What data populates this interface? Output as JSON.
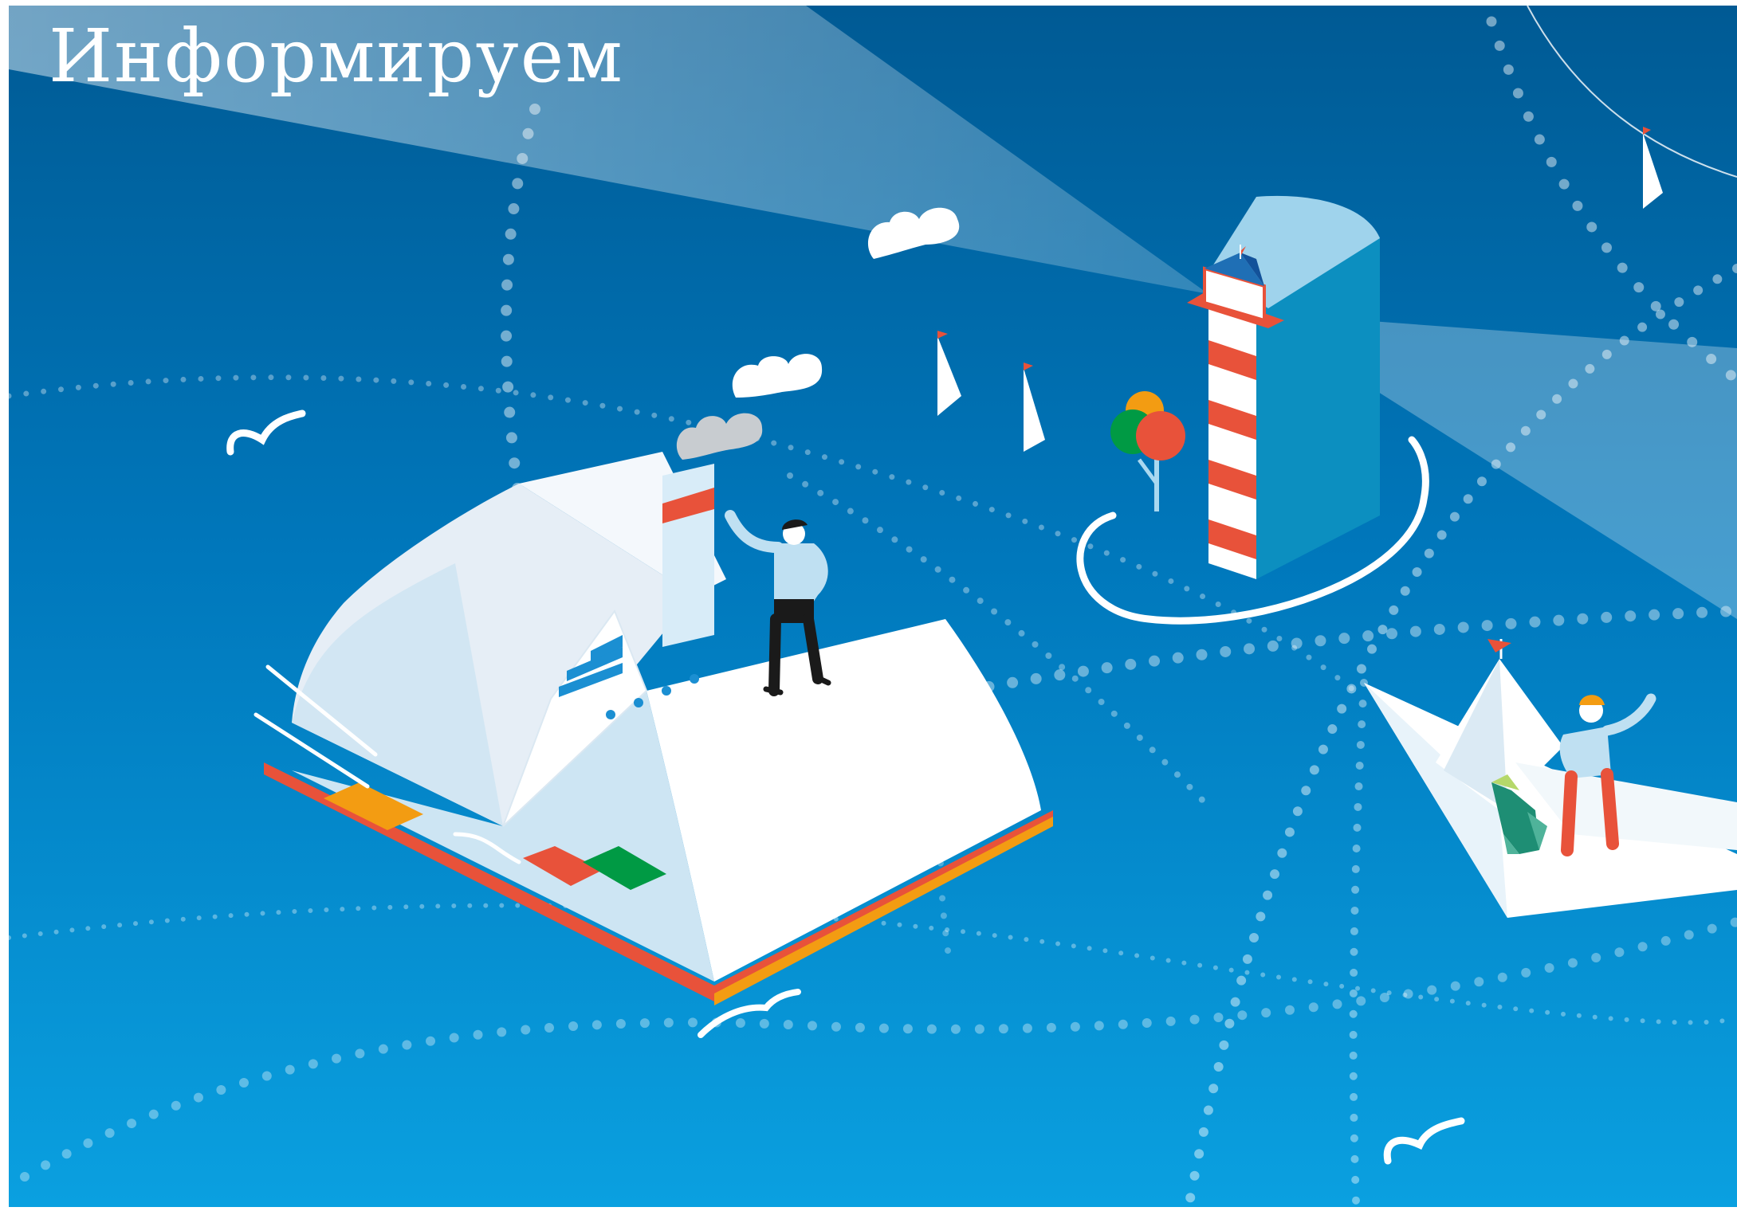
{
  "headline": "Информируем",
  "colors": {
    "sky_top": "#005a94",
    "sky_bottom": "#0aa0e0",
    "book_cover": "#e8523a",
    "book_page": "#ffffff",
    "lighthouse_stripe": "#e8523a",
    "beam": "#ffffff",
    "bookmark_yellow": "#f39c12",
    "bookmark_green": "#009a44",
    "balloon_orange": "#f39c12",
    "balloon_green": "#009a44",
    "balloon_red": "#e8523a"
  },
  "icons": [
    "open-book-island",
    "steamship-on-book",
    "lighthouse",
    "paper-boat",
    "seagull",
    "cloud",
    "sailboat",
    "balloons",
    "flag"
  ]
}
